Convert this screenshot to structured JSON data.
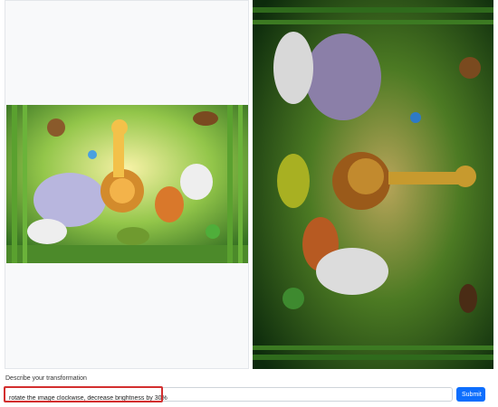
{
  "form": {
    "label": "Describe your transformation",
    "value": "rotate the image clockwise, decrease brightness by 30%",
    "submit_label": "Submit"
  },
  "images": {
    "left_alt": "Jungle cartoon animals",
    "right_alt": "Transformed jungle cartoon animals"
  }
}
